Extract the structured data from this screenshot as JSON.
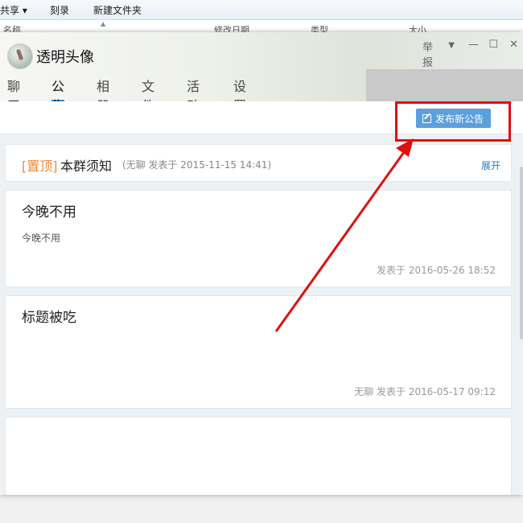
{
  "explorer": {
    "toolbar": [
      "共享 ▾",
      "刻录",
      "新建文件夹"
    ],
    "columns": [
      "名称",
      "修改日期",
      "类型",
      "大小"
    ]
  },
  "window": {
    "group_name": "透明头像",
    "report_label": "举报",
    "tabs": [
      "聊天",
      "公告",
      "相册",
      "文件",
      "活动",
      "设置"
    ],
    "active_tab": "公告"
  },
  "actions": {
    "publish_label": "发布新公告"
  },
  "announcements": {
    "pinned": {
      "tag": "[置顶]",
      "title": "本群须知",
      "meta": "(无聊 发表于 2015-11-15 14:41)",
      "expand_label": "展开"
    },
    "items": [
      {
        "title": "今晚不用",
        "body": "今晚不用",
        "meta": "发表于 2016-05-26 18:52"
      },
      {
        "title": "标题被吃",
        "body": "",
        "meta": "无聊 发表于 2016-05-17 09:12"
      },
      {
        "title": "",
        "body": "",
        "meta": ""
      }
    ]
  },
  "colors": {
    "accent": "#2d8ee0",
    "button": "#5b9fdc",
    "pinned_tag": "#f08a3c",
    "highlight": "#e01010"
  }
}
